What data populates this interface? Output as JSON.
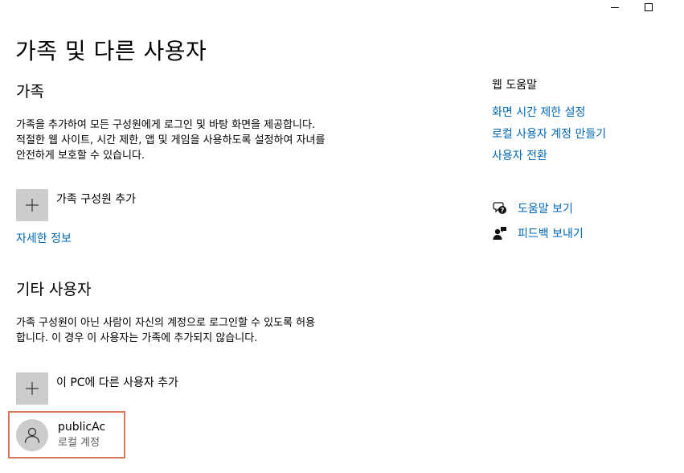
{
  "window": {
    "minimize_icon": "minimize-icon",
    "maximize_icon": "maximize-icon"
  },
  "page": {
    "title": "가족 및 다른 사용자"
  },
  "family": {
    "title": "가족",
    "description_lines": [
      "가족을 추가하여 모든 구성원에게 로그인 및 바탕 화면을 제공합니다.",
      "적절한 웹 사이트, 시간 제한, 앱 및 게임을 사용하도록 설정하여 자녀를",
      "안전하게 보호할 수 있습니다."
    ],
    "add_label": "가족 구성원 추가",
    "more_info_link": "자세한 정보"
  },
  "other_users": {
    "title": "기타 사용자",
    "description_lines": [
      "가족 구성원이 아닌 사람이 자신의 계정으로 로그인할 수 있도록 허용",
      "합니다. 이 경우 이 사용자는 가족에 추가되지 않습니다."
    ],
    "add_label": "이 PC에 다른 사용자 추가",
    "users": [
      {
        "name": "publicAc",
        "type": "로컬 계정"
      }
    ]
  },
  "sidebar": {
    "heading": "웹 도움말",
    "links": [
      "화면 시간 제한 설정",
      "로컬 사용자 계정 만들기",
      "사용자 전환"
    ],
    "get_help": "도움말 보기",
    "feedback": "피드백 보내기"
  },
  "colors": {
    "link": "#0067b8",
    "tile": "#cccccc",
    "selected_border": "#d9775a"
  }
}
